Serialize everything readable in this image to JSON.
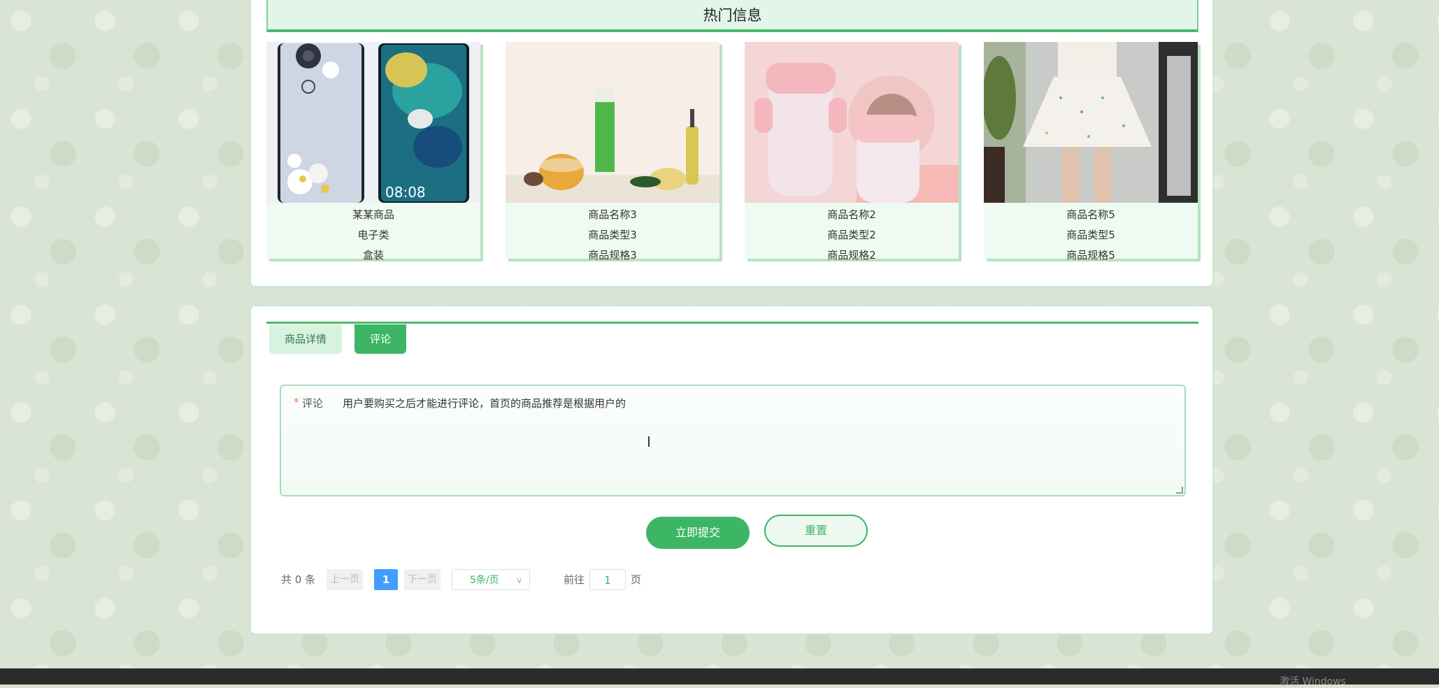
{
  "hot": {
    "title": "热门信息",
    "products": [
      {
        "name": "某某商品",
        "type": "电子类",
        "spec": "盒装"
      },
      {
        "name": "商品名称3",
        "type": "商品类型3",
        "spec": "商品规格3"
      },
      {
        "name": "商品名称2",
        "type": "商品类型2",
        "spec": "商品规格2"
      },
      {
        "name": "商品名称5",
        "type": "商品类型5",
        "spec": "商品规格5"
      }
    ]
  },
  "tabs": {
    "detail": "商品详情",
    "comment": "评论"
  },
  "form": {
    "required_mark": "*",
    "label": "评论",
    "value": "用户要购买之后才能进行评论，首页的商品推荐是根据用户的",
    "submit": "立即提交",
    "reset": "重置"
  },
  "pagination": {
    "total": "共 0 条",
    "prev": "上一页",
    "current": "1",
    "next": "下一页",
    "page_size": "5条/页",
    "goto_prefix": "前往",
    "goto_value": "1",
    "goto_suffix": "页"
  },
  "colors": {
    "accent": "#3cb665",
    "page_active": "#409eff"
  },
  "footer": {
    "text": "激活 Windows"
  }
}
